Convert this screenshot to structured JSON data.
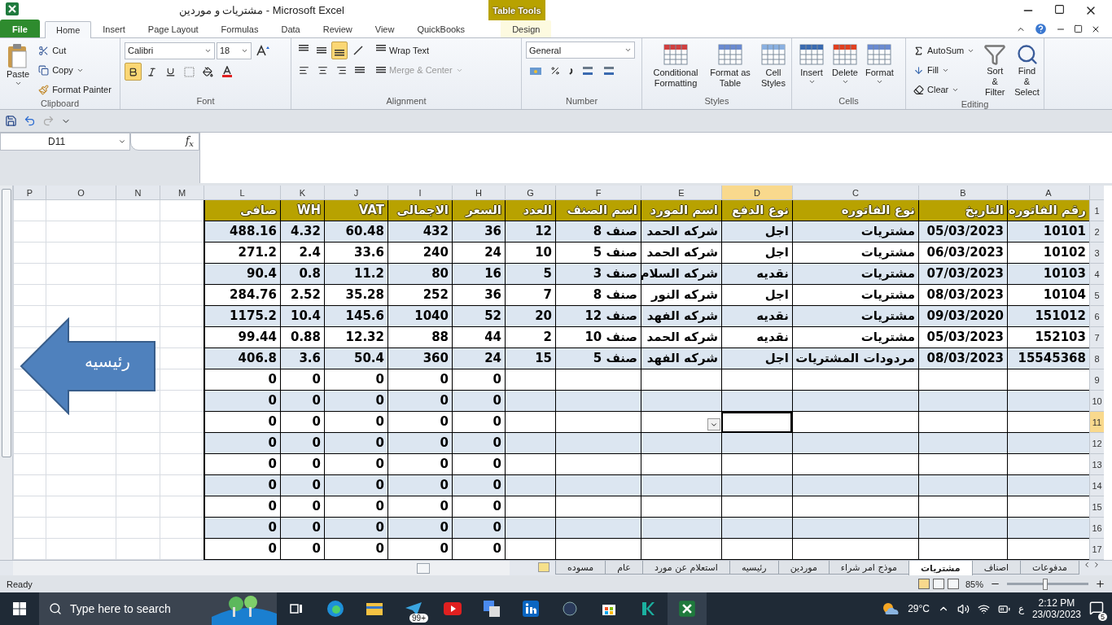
{
  "window": {
    "title": "مشتريات و موردين  -  Microsoft Excel",
    "context_tab": "Table Tools"
  },
  "tabs": {
    "file": {
      "label": "File",
      "kind": "file",
      "selected": false
    },
    "home": {
      "label": "Home",
      "kind": "tab",
      "selected": true
    },
    "insert": {
      "label": "Insert",
      "kind": "tab",
      "selected": false
    },
    "page_layout": {
      "label": "Page Layout",
      "kind": "tab",
      "selected": false
    },
    "formulas": {
      "label": "Formulas",
      "kind": "tab",
      "selected": false
    },
    "data": {
      "label": "Data",
      "kind": "tab",
      "selected": false
    },
    "review": {
      "label": "Review",
      "kind": "tab",
      "selected": false
    },
    "view": {
      "label": "View",
      "kind": "tab",
      "selected": false
    },
    "quickbooks": {
      "label": "QuickBooks",
      "kind": "tab",
      "selected": false
    },
    "design": {
      "label": "Design",
      "kind": "context",
      "selected": false
    }
  },
  "ribbon": {
    "clipboard": {
      "label": "Clipboard",
      "paste": "Paste",
      "cut": "Cut",
      "copy": "Copy",
      "format_painter": "Format Painter"
    },
    "font": {
      "label": "Font",
      "family": "Calibri",
      "size": "18",
      "bold": true,
      "italic": false,
      "underline": false
    },
    "alignment": {
      "label": "Alignment",
      "bottom_align": true,
      "wrap_text": "Wrap Text",
      "merge_center": "Merge & Center",
      "merge_disabled": true
    },
    "number": {
      "label": "Number",
      "format": "General"
    },
    "styles": {
      "label": "Styles",
      "buttons": {
        "conditional": "Conditional Formatting",
        "table": "Format as Table",
        "cell": "Cell Styles"
      }
    },
    "cells": {
      "label": "Cells",
      "buttons": {
        "insert": "Insert",
        "delete": "Delete",
        "format": "Format"
      }
    },
    "editing": {
      "label": "Editing",
      "autosum": "AutoSum",
      "fill": "Fill",
      "clear": "Clear",
      "sort": "Sort & Filter",
      "find": "Find & Select"
    }
  },
  "name_box": "D11",
  "function_label": "f$_{x}$",
  "sheet": {
    "columns": [
      {
        "letter": "A",
        "selected": false
      },
      {
        "letter": "B",
        "selected": false
      },
      {
        "letter": "C",
        "selected": false
      },
      {
        "letter": "D",
        "selected": true
      },
      {
        "letter": "E",
        "selected": false
      },
      {
        "letter": "F",
        "selected": false
      },
      {
        "letter": "G",
        "selected": false
      },
      {
        "letter": "H",
        "selected": false
      },
      {
        "letter": "I",
        "selected": false
      },
      {
        "letter": "J",
        "selected": false
      },
      {
        "letter": "K",
        "selected": false
      },
      {
        "letter": "L",
        "selected": false
      },
      {
        "letter": "M",
        "selected": false
      },
      {
        "letter": "N",
        "selected": false
      },
      {
        "letter": "O",
        "selected": false
      },
      {
        "letter": "P",
        "selected": false
      }
    ],
    "rows": [
      {
        "number": "1",
        "selected": false,
        "kind": "header",
        "cells": [
          "رقم الفاتوره",
          "التاريخ",
          "نوع الفاتوره",
          "نوع الدفع",
          "اسم المورد",
          "اسم الصنف",
          "العدد",
          "السعر",
          "الاجمالى",
          "VAT",
          "WH",
          "صافى"
        ]
      },
      {
        "number": "2",
        "selected": false,
        "kind": "data",
        "cells": [
          "10101",
          "05/03/2023",
          "مشتريات",
          "اجل",
          "شركه الحمد",
          "صنف 8",
          "12",
          "36",
          "432",
          "60.48",
          "4.32",
          "488.16"
        ]
      },
      {
        "number": "3",
        "selected": false,
        "kind": "data",
        "cells": [
          "10102",
          "06/03/2023",
          "مشتريات",
          "اجل",
          "شركه الحمد",
          "صنف 5",
          "10",
          "24",
          "240",
          "33.6",
          "2.4",
          "271.2"
        ]
      },
      {
        "number": "4",
        "selected": false,
        "kind": "data",
        "cells": [
          "10103",
          "07/03/2023",
          "مشتريات",
          "نقديه",
          "شركه السلام",
          "صنف 3",
          "5",
          "16",
          "80",
          "11.2",
          "0.8",
          "90.4"
        ]
      },
      {
        "number": "5",
        "selected": false,
        "kind": "data",
        "cells": [
          "10104",
          "08/03/2023",
          "مشتريات",
          "اجل",
          "شركه النور",
          "صنف 8",
          "7",
          "36",
          "252",
          "35.28",
          "2.52",
          "284.76"
        ]
      },
      {
        "number": "6",
        "selected": false,
        "kind": "data",
        "cells": [
          "151012",
          "09/03/2020",
          "مشتريات",
          "نقديه",
          "شركه الفهد",
          "صنف 12",
          "20",
          "52",
          "1040",
          "145.6",
          "10.4",
          "1175.2"
        ]
      },
      {
        "number": "7",
        "selected": false,
        "kind": "data",
        "cells": [
          "152103",
          "05/03/2023",
          "مشتريات",
          "نقديه",
          "شركه الحمد",
          "صنف 10",
          "2",
          "44",
          "88",
          "12.32",
          "0.88",
          "99.44"
        ]
      },
      {
        "number": "8",
        "selected": false,
        "kind": "data",
        "cells": [
          "15545368",
          "08/03/2023",
          "مردودات المشتريات",
          "اجل",
          "شركه الفهد",
          "صنف 5",
          "15",
          "24",
          "360",
          "50.4",
          "3.6",
          "406.8"
        ]
      },
      {
        "number": "9",
        "selected": false,
        "kind": "data",
        "cells": [
          null,
          null,
          null,
          null,
          null,
          null,
          null,
          "0",
          "0",
          "0",
          "0",
          "0"
        ]
      },
      {
        "number": "10",
        "selected": false,
        "kind": "data",
        "cells": [
          null,
          null,
          null,
          null,
          null,
          null,
          null,
          "0",
          "0",
          "0",
          "0",
          "0"
        ]
      },
      {
        "number": "11",
        "selected": true,
        "kind": "data",
        "cells": [
          null,
          null,
          null,
          null,
          null,
          null,
          null,
          "0",
          "0",
          "0",
          "0",
          "0"
        ]
      },
      {
        "number": "12",
        "selected": false,
        "kind": "data",
        "cells": [
          null,
          null,
          null,
          null,
          null,
          null,
          null,
          "0",
          "0",
          "0",
          "0",
          "0"
        ]
      },
      {
        "number": "13",
        "selected": false,
        "kind": "data",
        "cells": [
          null,
          null,
          null,
          null,
          null,
          null,
          null,
          "0",
          "0",
          "0",
          "0",
          "0"
        ]
      },
      {
        "number": "14",
        "selected": false,
        "kind": "data",
        "cells": [
          null,
          null,
          null,
          null,
          null,
          null,
          null,
          "0",
          "0",
          "0",
          "0",
          "0"
        ]
      },
      {
        "number": "15",
        "selected": false,
        "kind": "data",
        "cells": [
          null,
          null,
          null,
          null,
          null,
          null,
          null,
          "0",
          "0",
          "0",
          "0",
          "0"
        ]
      },
      {
        "number": "16",
        "selected": false,
        "kind": "data",
        "cells": [
          null,
          null,
          null,
          null,
          null,
          null,
          null,
          "0",
          "0",
          "0",
          "0",
          "0"
        ]
      },
      {
        "number": "17",
        "selected": false,
        "kind": "data",
        "cells": [
          null,
          null,
          null,
          null,
          null,
          null,
          null,
          "0",
          "0",
          "0",
          "0",
          "0"
        ]
      }
    ]
  },
  "shape": {
    "kind": "arrow",
    "label": "رئيسيه"
  },
  "sheet_tabs": [
    {
      "label": "مدفوعات",
      "selected": false
    },
    {
      "label": "اصناف",
      "selected": false
    },
    {
      "label": "مشتريات",
      "selected": true
    },
    {
      "label": "موذج امر شراء",
      "selected": false
    },
    {
      "label": "موردين",
      "selected": false
    },
    {
      "label": "رئيسيه",
      "selected": false
    },
    {
      "label": "استعلام عن مورد",
      "selected": false
    },
    {
      "label": "عام",
      "selected": false
    },
    {
      "label": "مسوده",
      "selected": false
    }
  ],
  "status_bar": {
    "mode": "Ready",
    "zoom": "85%",
    "zoom_slider": {
      "level": 0.47
    }
  },
  "taskbar": {
    "search": "Type here to search",
    "badge": "99+",
    "temperature": "29°C",
    "language": "ع",
    "time": "2:12 PM",
    "date": "23/03/2023",
    "notifications": "5"
  }
}
